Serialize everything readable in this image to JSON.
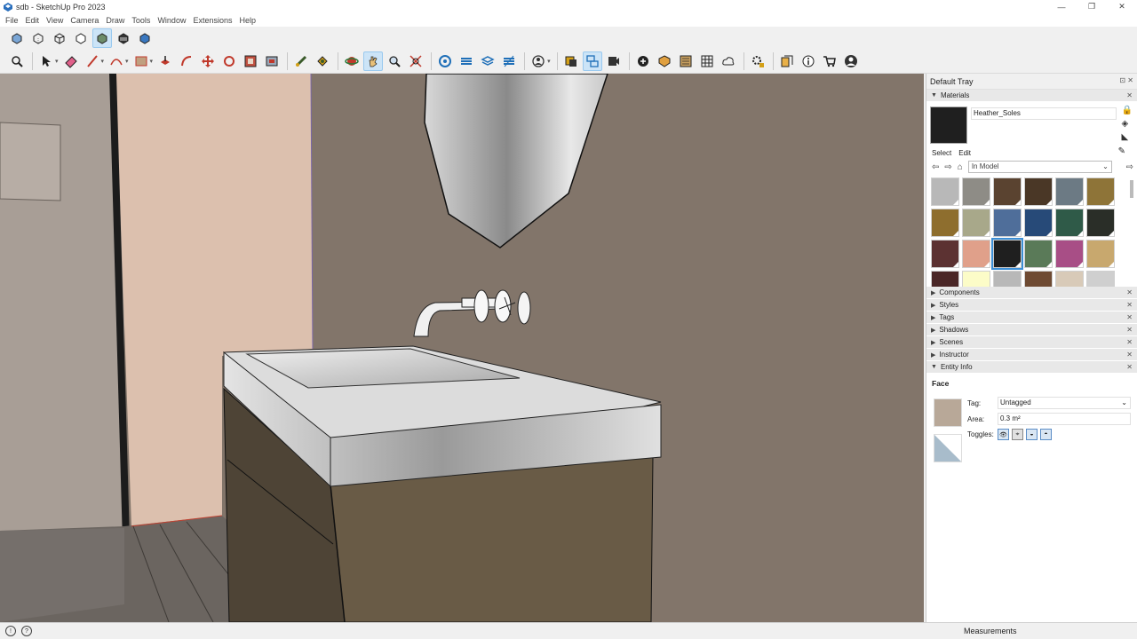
{
  "window": {
    "title": "sdb - SketchUp Pro 2023",
    "minimize_glyph": "—",
    "maximize_glyph": "❐",
    "close_glyph": "✕"
  },
  "menu": [
    "File",
    "Edit",
    "View",
    "Camera",
    "Draw",
    "Tools",
    "Window",
    "Extensions",
    "Help"
  ],
  "toolbar_styles": [
    "xray-icon",
    "back-edges-icon",
    "wireframe-icon",
    "hidden-line-icon",
    "shaded-icon",
    "shaded-textures-icon",
    "monochrome-icon"
  ],
  "toolbar_main": [
    "zoom-icon",
    "select-icon",
    "eraser-icon",
    "line-icon",
    "arc-icon",
    "rectangle-icon",
    "push-pull-icon",
    "follow-me-icon",
    "move-icon",
    "rotate-icon",
    "scale-icon",
    "offset-icon",
    "tape-measure-icon",
    "paint-bucket-icon",
    "orbit-icon",
    "pan-icon",
    "zoom-window-icon",
    "zoom-extents-icon",
    "section-plane-icon",
    "section-display-icon",
    "section-fill-icon",
    "section-cut-icon",
    "tags-icon",
    "components-icon",
    "outliner-icon",
    "instructor-icon",
    "add-location-icon",
    "sandbox-icon",
    "materials-icon",
    "geo-icon",
    "cloud-icon",
    "extension-manager-icon",
    "model-info-icon",
    "info-icon",
    "warehouse-icon",
    "account-icon"
  ],
  "tray": {
    "title": "Default Tray",
    "header_controls": "⊡ ✕",
    "materials_panel": {
      "title": "Materials",
      "current_material": "Heather_Soles",
      "tabs": [
        "Select",
        "Edit"
      ],
      "collection": "In Model",
      "side_icons": [
        "🔒",
        "◈",
        "◣"
      ],
      "nav_glyphs": [
        "⇦",
        "⇨",
        "⌂"
      ],
      "go_glyph": "⇨",
      "pencil_glyph": "✎",
      "swatches": [
        "#b8b8b8",
        "#8e8c86",
        "#5a4330",
        "#4a3726",
        "#6c7a84",
        "#8e7438",
        "#8e6e2e",
        "#a8a88a",
        "#4f6e9a",
        "#274a78",
        "#2f5a48",
        "#2a2e28",
        "#5c3232",
        "#e0a08a",
        "#1f1f1f",
        "#5a7a58",
        "#a84e86",
        "#c8a86e",
        "#4a2626",
        "#fcfcc8",
        "#b8b8b8",
        "#6e4a32",
        "#d8cab8",
        "#cfcfcf"
      ],
      "selected_index": 14
    },
    "collapsed_panels": [
      "Components",
      "Styles",
      "Tags",
      "Shadows",
      "Scenes",
      "Instructor"
    ],
    "entity_info": {
      "title": "Entity Info",
      "type": "Face",
      "tag_label": "Tag:",
      "tag_value": "Untagged",
      "area_label": "Area:",
      "area_value": "0.3 m²",
      "toggles_label": "Toggles:",
      "toggle_glyphs": [
        "👁",
        "⌖",
        "◒",
        "◓"
      ]
    }
  },
  "statusbar": {
    "measurements_label": "Measurements",
    "icons": [
      "!",
      "?"
    ]
  },
  "colors": {
    "back_wall": "#82756a",
    "side_wall": "#dcc0ae",
    "cabinet_front": "#695b46",
    "countertop": "#dcdcdc",
    "floor": "#6b6560",
    "selection_blue": "#3d8fd6"
  }
}
